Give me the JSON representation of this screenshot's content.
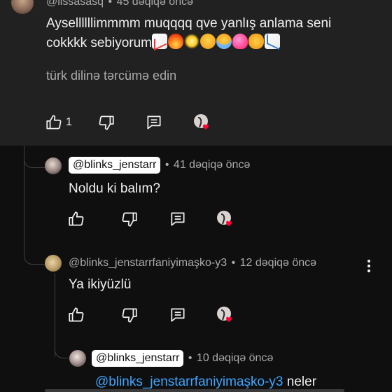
{
  "comments": [
    {
      "handle": "@lissasasq",
      "time": "45 dəqiqə öncə",
      "text": "Aysellllllimmmm muqqqq qve yanlış anlama seni cokkkk sebiyorum",
      "emojis": [
        "chart-increasing-emoji",
        "fire-emoji",
        "glowing-star-emoji",
        "face-with-steam-emoji",
        "loudly-crying-face-emoji",
        "heart-with-ribbon-emoji",
        "heart-eyes-cat-emoji",
        "chart-decreasing-emoji"
      ],
      "translate": "türk dilinə tərcümə edin",
      "like_count": "1"
    },
    {
      "handle": "@blinks_jenstarr",
      "time": "41 dəqiqə öncə",
      "text": "Noldu ki balım?"
    },
    {
      "handle": "@blinks_jenstarrfaniyimaşko-y3",
      "time": "12 dəqiqə öncə",
      "text": "Ya ikiyüzlü"
    },
    {
      "handle": "@blinks_jenstarr",
      "time": "10 dəqiqə öncə",
      "mention": "@blinks_jenstarrfaniyimaşko-y3",
      "text_tail": " neler"
    }
  ],
  "separator": "•"
}
